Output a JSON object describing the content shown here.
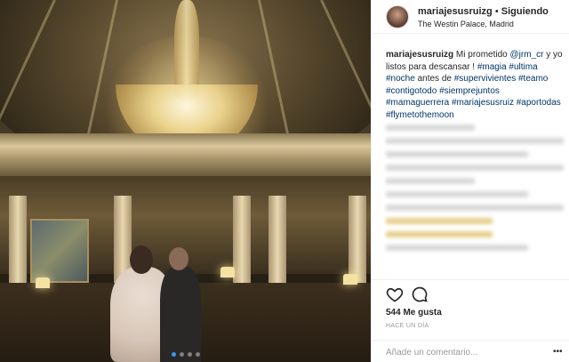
{
  "post": {
    "username": "mariajesusruizg",
    "separator": " • ",
    "follow_status": "Siguiendo",
    "location": "The Westin Palace, Madrid"
  },
  "caption": {
    "author": "mariajesusruizg",
    "text_1": " Mi prometido ",
    "mention": "@jrm_cr",
    "text_2": " y yo listos para descansar ! ",
    "tag_1": "#magia",
    "tag_2": "#ultima",
    "tag_3": "#noche",
    "text_3": " antes de ",
    "tag_4": "#supervivientes",
    "tag_5": "#teamo",
    "tag_6": "#contigotodo",
    "tag_7": "#siemprejuntos",
    "tag_8": "#mamaguerrera",
    "tag_9": "#mariajesusruiz",
    "tag_10": "#aportodas",
    "tag_11": "#flymetothemoon"
  },
  "actions": {
    "like_icon": "heart-icon",
    "comment_icon": "comment-icon"
  },
  "likes": "544 Me gusta",
  "timestamp": "HACE UN DÍA",
  "comment": {
    "placeholder": "Añade un comentario...",
    "more_icon": "ellipsis-icon"
  },
  "carousel": {
    "count": 4,
    "active": 0
  },
  "colors": {
    "link": "#003569",
    "accent": "#3897f0",
    "text": "#262626",
    "muted": "#999999"
  }
}
